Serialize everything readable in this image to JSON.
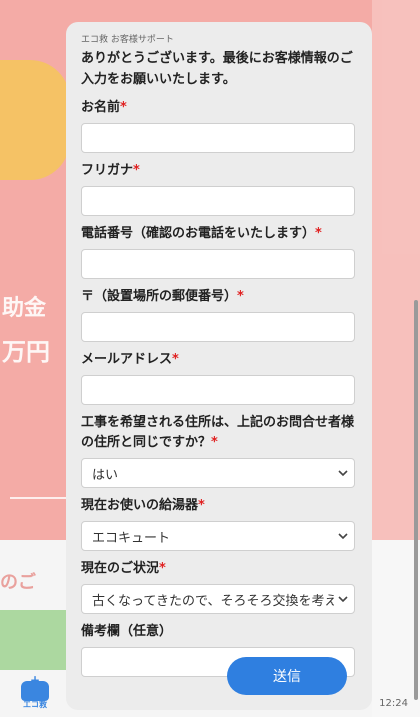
{
  "form": {
    "brand": "エコ救 お客様サポート",
    "intro": "ありがとうございます。最後にお客様情報のご入力をお願いいたします。",
    "required_mark": "*",
    "fields": {
      "name": {
        "label": "お名前",
        "value": ""
      },
      "furigana": {
        "label": "フリガナ",
        "value": ""
      },
      "phone": {
        "label": "電話番号（確認のお電話をいたします）",
        "value": ""
      },
      "postal": {
        "label": "〒（設置場所の郵便番号）",
        "value": ""
      },
      "email": {
        "label": "メールアドレス",
        "value": ""
      },
      "same_address": {
        "label": "工事を希望される住所は、上記のお問合せ者様の住所と同じですか？",
        "selected": "はい"
      },
      "water_heater": {
        "label": "現在お使いの給湯器",
        "selected": "エコキュート"
      },
      "status": {
        "label": "現在のご状況",
        "selected": "古くなってきたので、そろそろ交換を考えてい"
      },
      "remarks": {
        "label": "備考欄（任意）",
        "value": ""
      }
    },
    "submit_label": "送信"
  },
  "background": {
    "subsidy_text": "助金",
    "yen_text": "万円",
    "consult_text": "のご"
  },
  "logo": {
    "icon": "ambulance-icon",
    "text": "エコ救"
  },
  "time": "12:24",
  "colors": {
    "accent": "#2f7fe0",
    "required": "#e02020",
    "panel": "#ececec"
  }
}
